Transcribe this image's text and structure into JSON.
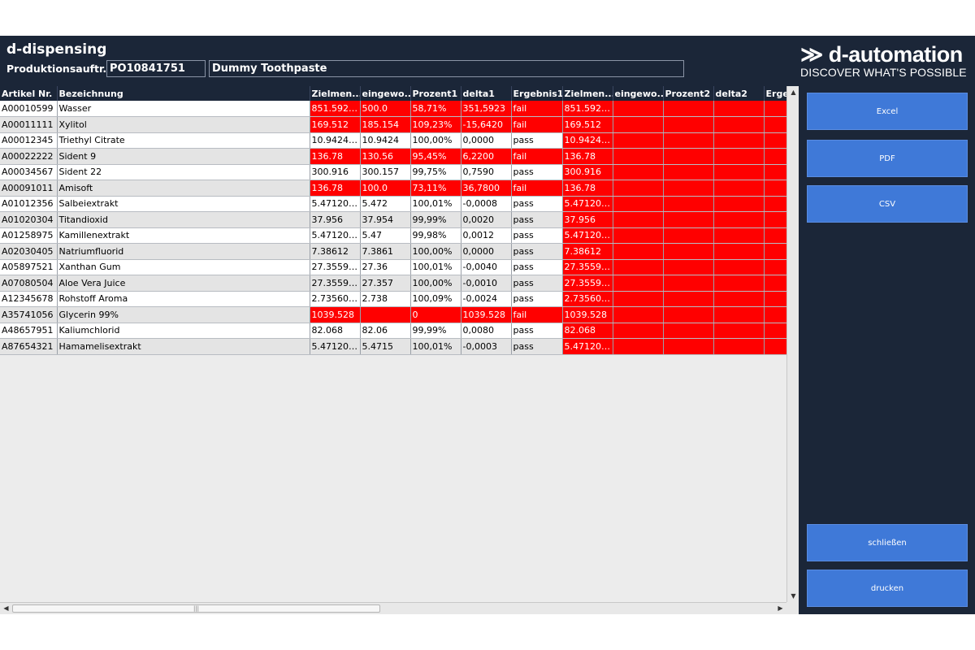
{
  "header": {
    "app_title": "d-dispensing",
    "po_label": "Produktionsauftr...",
    "po_number": "PO10841751",
    "product_name": "Dummy Toothpaste",
    "logo_main": "≫ d-automation",
    "logo_tagline": "DISCOVER WHAT'S POSSIBLE"
  },
  "table": {
    "columns": [
      "Artikel Nr.",
      "Bezeichnung",
      "Zielmen...",
      "eingewo...",
      "Prozent1",
      "delta1",
      "Ergebnis1",
      "Zielmen...",
      "eingewo...",
      "Prozent2",
      "delta2",
      "Erge"
    ],
    "rows": [
      {
        "cells": [
          "A00010599",
          "Wasser",
          "851.5922...",
          "500.0",
          "58,71%",
          "351,5923",
          "fail",
          "851.5922...",
          "",
          "",
          "",
          ""
        ],
        "fail": true
      },
      {
        "cells": [
          "A00011111",
          "Xylitol",
          "169.512",
          "185.154",
          "109,23%",
          "-15,6420",
          "fail",
          "169.512",
          "",
          "",
          "",
          ""
        ],
        "fail": true
      },
      {
        "cells": [
          "A00012345",
          "Triethyl Citrate",
          "10.94240...",
          "10.9424",
          "100,00%",
          "0,0000",
          "pass",
          "10.94240...",
          "",
          "",
          "",
          ""
        ],
        "fail": false
      },
      {
        "cells": [
          "A00022222",
          "Sident 9",
          "136.78",
          "130.56",
          "95,45%",
          "6,2200",
          "fail",
          "136.78",
          "",
          "",
          "",
          ""
        ],
        "fail": true
      },
      {
        "cells": [
          "A00034567",
          "Sident 22",
          "300.916",
          "300.157",
          "99,75%",
          "0,7590",
          "pass",
          "300.916",
          "",
          "",
          "",
          ""
        ],
        "fail": false
      },
      {
        "cells": [
          "A00091011",
          "Amisoft",
          "136.78",
          "100.0",
          "73,11%",
          "36,7800",
          "fail",
          "136.78",
          "",
          "",
          "",
          ""
        ],
        "fail": true
      },
      {
        "cells": [
          "A01012356",
          "Salbeiextrakt",
          "5.471200...",
          "5.472",
          "100,01%",
          "-0,0008",
          "pass",
          "5.471200...",
          "",
          "",
          "",
          ""
        ],
        "fail": false
      },
      {
        "cells": [
          "A01020304",
          "Titandioxid",
          "37.956",
          "37.954",
          "99,99%",
          "0,0020",
          "pass",
          "37.956",
          "",
          "",
          "",
          ""
        ],
        "fail": false
      },
      {
        "cells": [
          "A01258975",
          "Kamillenextrakt",
          "5.471200...",
          "5.47",
          "99,98%",
          "0,0012",
          "pass",
          "5.471200...",
          "",
          "",
          "",
          ""
        ],
        "fail": false
      },
      {
        "cells": [
          "A02030405",
          "Natriumfluorid",
          "7.38612",
          "7.3861",
          "100,00%",
          "0,0000",
          "pass",
          "7.38612",
          "",
          "",
          "",
          ""
        ],
        "fail": false
      },
      {
        "cells": [
          "A05897521",
          "Xanthan Gum",
          "27.35599...",
          "27.36",
          "100,01%",
          "-0,0040",
          "pass",
          "27.35599...",
          "",
          "",
          "",
          ""
        ],
        "fail": false
      },
      {
        "cells": [
          "A07080504",
          "Aloe Vera Juice",
          "27.35599...",
          "27.357",
          "100,00%",
          "-0,0010",
          "pass",
          "27.35599...",
          "",
          "",
          "",
          ""
        ],
        "fail": false
      },
      {
        "cells": [
          "A12345678",
          "Rohstoff Aroma",
          "2.735600...",
          "2.738",
          "100,09%",
          "-0,0024",
          "pass",
          "2.735600...",
          "",
          "",
          "",
          ""
        ],
        "fail": false
      },
      {
        "cells": [
          "A35741056",
          "Glycerin 99%",
          "1039.528",
          "",
          "0",
          "1039.528",
          "fail",
          "1039.528",
          "",
          "",
          "",
          ""
        ],
        "fail": true
      },
      {
        "cells": [
          "A48657951",
          "Kaliumchlorid",
          "82.068",
          "82.06",
          "99,99%",
          "0,0080",
          "pass",
          "82.068",
          "",
          "",
          "",
          ""
        ],
        "fail": false
      },
      {
        "cells": [
          "A87654321",
          "Hamamelisextrakt",
          "5.471200...",
          "5.4715",
          "100,01%",
          "-0,0003",
          "pass",
          "5.471200...",
          "",
          "",
          "",
          ""
        ],
        "fail": false
      }
    ]
  },
  "scrollbar": {
    "up_arrow": "▲",
    "down_arrow": "▼",
    "left_arrow": "◀",
    "right_arrow": "▶",
    "grip": "|||"
  },
  "buttons": {
    "excel": "Excel",
    "pdf": "PDF",
    "csv": "CSV",
    "close": "schließen",
    "print": "drucken"
  },
  "colors": {
    "background": "#1b2638",
    "fail": "#ff0000",
    "button": "#3f79d8"
  }
}
